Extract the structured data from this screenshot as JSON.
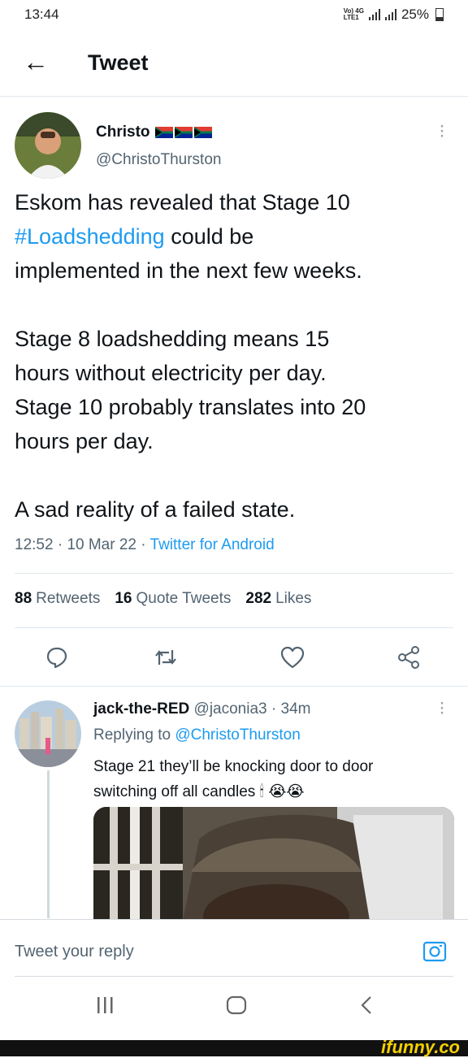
{
  "status_bar": {
    "time": "13:44",
    "network_label": "Vo) 4G",
    "lte_label": "LTE1",
    "battery": "25%"
  },
  "header": {
    "title": "Tweet"
  },
  "tweet": {
    "author_name": "Christo",
    "author_handle": "@ChristoThurston",
    "text_before_hashtag": "Eskom has revealed that Stage 10",
    "hashtag": "#Loadshedding",
    "text_after_hashtag": " could be\nimplemented in the next few weeks.\n\nStage 8 loadshedding means 15\nhours without electricity per day.\nStage 10 probably translates into 20\nhours per day.\n\nA sad reality of a failed state.",
    "time": "12:52",
    "date": "10 Mar 22",
    "source": "Twitter for Android",
    "separator": "·",
    "stats": {
      "retweets_count": "88",
      "retweets_label": "Retweets",
      "quotes_count": "16",
      "quotes_label": "Quote Tweets",
      "likes_count": "282",
      "likes_label": "Likes"
    }
  },
  "reply": {
    "author_name": "jack-the-RED",
    "author_handle": "@jaconia3",
    "age": "34m",
    "replying_to_label": "Replying to",
    "replying_to_handle": "@ChristoThurston",
    "text": "Stage 21 they’ll be knocking door to door\nswitching off all candles 🕯 😭😭"
  },
  "compose": {
    "placeholder": "Tweet your reply"
  },
  "watermark": "ifunny.co",
  "colors": {
    "accent": "#1d9bf0",
    "secondary_text": "#536471",
    "divider": "#e1e8ed"
  }
}
